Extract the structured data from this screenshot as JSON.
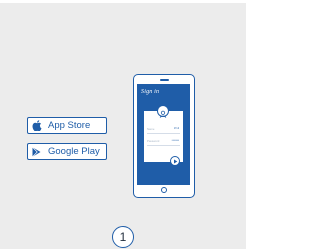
{
  "stores": {
    "app_store": {
      "label": "App Store",
      "icon": "apple-icon"
    },
    "google_play": {
      "label": "Google Play",
      "icon": "play-store-icon"
    }
  },
  "phone": {
    "screen_title": "Sign in",
    "fields": [
      {
        "label": "Name",
        "value": "3>4"
      },
      {
        "label": "Password",
        "value": "•••••••"
      }
    ],
    "submit_icon": "play-arrow-icon"
  },
  "step": {
    "number": "1"
  },
  "colors": {
    "accent": "#1f5da8",
    "background": "#ececec"
  }
}
